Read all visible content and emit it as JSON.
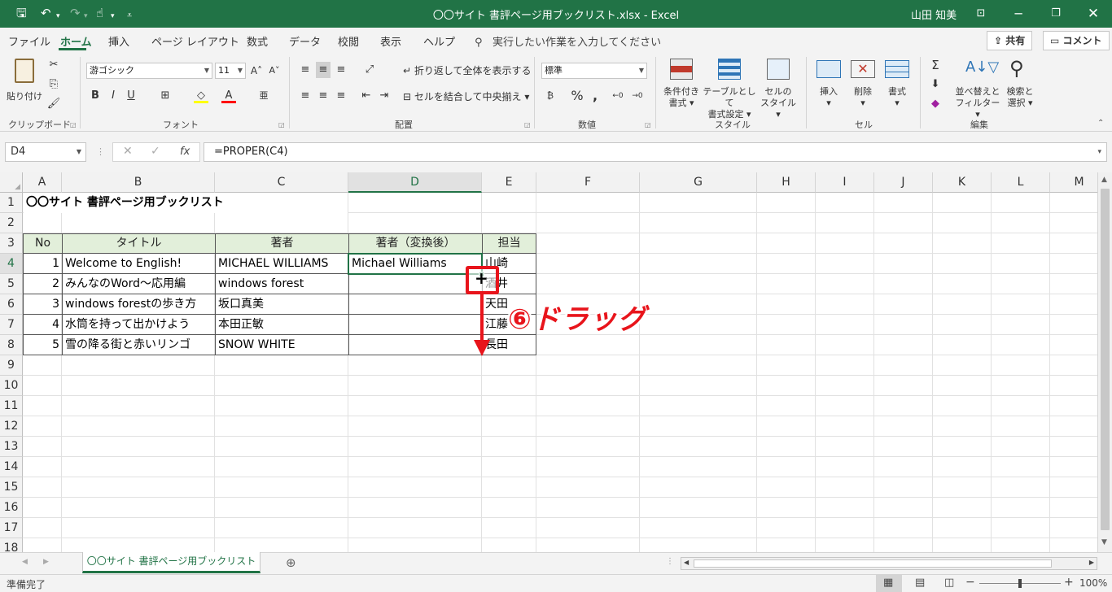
{
  "window": {
    "title": "〇〇サイト 書評ページ用ブックリスト.xlsx  -  Excel",
    "user": "山田 知美"
  },
  "tabs": [
    "ファイル",
    "ホーム",
    "挿入",
    "ページ レイアウト",
    "数式",
    "データ",
    "校閲",
    "表示",
    "ヘルプ"
  ],
  "search_placeholder": "実行したい作業を入力してください",
  "share_label": "共有",
  "comment_label": "コメント",
  "ribbon": {
    "paste_label": "貼り付け",
    "clipboard_label": "クリップボード",
    "font_name": "游ゴシック",
    "font_size": "11",
    "font_label": "フォント",
    "wrap_label": "折り返して全体を表示する",
    "merge_label": "セルを結合して中央揃え",
    "align_label": "配置",
    "number_format": "標準",
    "number_label": "数値",
    "cond_format_label1": "条件付き",
    "cond_format_label2": "書式",
    "table_format_label1": "テーブルとして",
    "table_format_label2": "書式設定",
    "cell_style_label1": "セルの",
    "cell_style_label2": "スタイル",
    "style_label": "スタイル",
    "insert_label": "挿入",
    "delete_label": "削除",
    "format_label": "書式",
    "cells_label": "セル",
    "sort_label1": "並べ替えと",
    "sort_label2": "フィルター",
    "find_label1": "検索と",
    "find_label2": "選択",
    "edit_label": "編集"
  },
  "formula_bar": {
    "name_box": "D4",
    "formula": "=PROPER(C4)"
  },
  "columns": [
    "A",
    "B",
    "C",
    "D",
    "E",
    "F",
    "G",
    "H",
    "I",
    "J",
    "K",
    "L",
    "M"
  ],
  "rows": [
    "1",
    "2",
    "3",
    "4",
    "5",
    "6",
    "7",
    "8",
    "9",
    "10",
    "11",
    "12",
    "13",
    "14",
    "15",
    "16",
    "17",
    "18"
  ],
  "sheet": {
    "title": "〇〇サイト 書評ページ用ブックリスト",
    "headers": [
      "No",
      "タイトル",
      "著者",
      "著者（変換後）",
      "担当"
    ],
    "data": [
      [
        "1",
        "Welcome to English!",
        "MICHAEL WILLIAMS",
        "Michael Williams",
        "山崎"
      ],
      [
        "2",
        "みんなのWord～応用編",
        "windows forest",
        "",
        "酒井"
      ],
      [
        "3",
        "windows forestの歩き方",
        "坂口真美",
        "",
        "天田"
      ],
      [
        "4",
        "水筒を持って出かけよう",
        "本田正敏",
        "",
        "江藤"
      ],
      [
        "5",
        "雪の降る街と赤いリンゴ",
        "SNOW WHITE",
        "",
        "長田"
      ]
    ]
  },
  "annotation": "⑥ドラッグ",
  "sheet_tab": "〇〇サイト 書評ページ用ブックリスト",
  "status": {
    "ready": "準備完了",
    "zoom": "100%"
  }
}
